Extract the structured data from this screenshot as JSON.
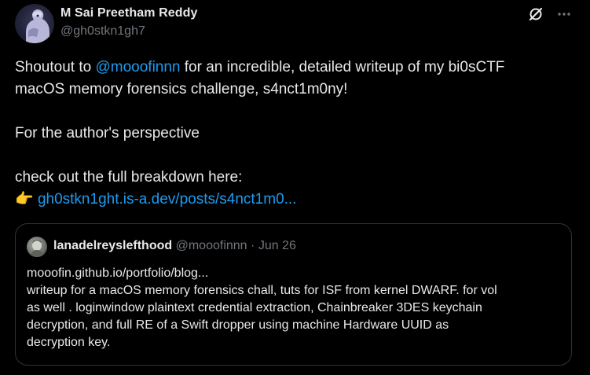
{
  "author": {
    "name": "M Sai Preetham Reddy",
    "handle": "@gh0stkn1gh7"
  },
  "post": {
    "line1_prefix": "Shoutout to ",
    "mention": "@mooofinnn",
    "line1_suffix": " for an incredible, detailed writeup of my bi0sCTF",
    "line2": "macOS memory forensics challenge, s4nct1m0ny!",
    "line3": "For the author's perspective",
    "line4": "check out the full breakdown here:",
    "pointer_emoji": "👉",
    "link_text": "gh0stkn1ght.is-a.dev/posts/s4nct1m0..."
  },
  "quote": {
    "name": "lanadelreyslefthood",
    "handle": "@mooofinnn",
    "separator": "·",
    "date": "Jun 26",
    "lines": [
      "mooofin.github.io/portfolio/blog...",
      "writeup for a macOS memory forensics chall,  tuts for ISF from kernel DWARF. for vol",
      "as well . loginwindow plaintext credential extraction, Chainbreaker 3DES keychain",
      "decryption, and full RE of a Swift dropper using machine Hardware UUID as",
      "decryption key."
    ]
  },
  "icons": {
    "grok": "grok-icon",
    "more": "more-icon"
  },
  "colors": {
    "background": "#000000",
    "text": "#e7e9ea",
    "muted": "#71767b",
    "link": "#1d9bf0",
    "border": "#2f3336"
  }
}
